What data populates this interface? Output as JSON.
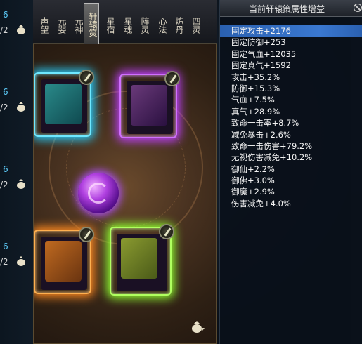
{
  "left_list": {
    "rows": [
      {
        "level": "6",
        "count": "/2"
      },
      {
        "level": "6",
        "count": "/2"
      },
      {
        "level": "6",
        "count": "/2"
      },
      {
        "level": "6",
        "count": "/2"
      }
    ],
    "bag_icon": "money-bag-icon"
  },
  "tabs": [
    {
      "label": "声望",
      "active": false
    },
    {
      "label": "元婴",
      "active": false
    },
    {
      "label": "元神",
      "active": false
    },
    {
      "label": "轩辕策",
      "active": true
    },
    {
      "label": "星宿",
      "active": false
    },
    {
      "label": "星魂",
      "active": false
    },
    {
      "label": "阵灵",
      "active": false
    },
    {
      "label": "心法",
      "active": false
    },
    {
      "label": "炼丹",
      "active": false
    },
    {
      "label": "四灵",
      "active": false
    }
  ],
  "cards": [
    {
      "name": "blue-book",
      "color": "#28d0ff"
    },
    {
      "name": "purple-book",
      "color": "#c040ff"
    },
    {
      "name": "orange-book",
      "color": "#ff8a20"
    },
    {
      "name": "green-book",
      "color": "#90ff30"
    }
  ],
  "stats_panel": {
    "title": "当前轩辕策属性增益",
    "selected_index": 0,
    "rows": [
      "固定攻击+2176",
      "固定防御+253",
      "固定气血+12035",
      "固定真气+1592",
      "攻击+35.2%",
      "防御+15.3%",
      "气血+7.5%",
      "真气+28.9%",
      "致命一击率+8.7%",
      "减免暴击+2.6%",
      "致命一击伤害+79.2%",
      "无视伤害减免+10.2%",
      "御仙+2.2%",
      "御佛+3.0%",
      "御魔+2.9%",
      "伤害减免+4.0%"
    ]
  },
  "colors": {
    "selected_row": "#3a78d0",
    "level_text": "#5fd0ff",
    "panel_bg": "#0a101a"
  }
}
